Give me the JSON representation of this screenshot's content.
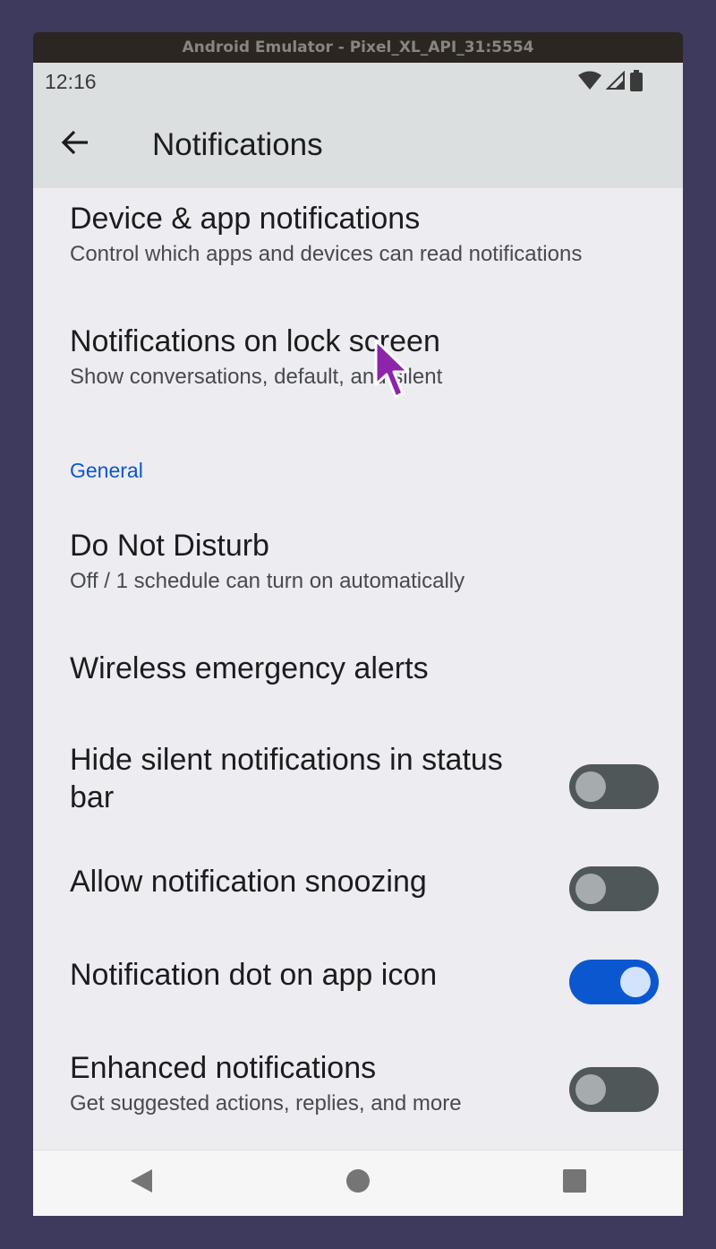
{
  "window": {
    "title": "Android Emulator - Pixel_XL_API_31:5554"
  },
  "status_bar": {
    "time": "12:16",
    "icons": [
      "wifi-icon",
      "cell-signal-icon",
      "battery-icon"
    ]
  },
  "app_bar": {
    "title": "Notifications",
    "back_icon": "arrow-back-icon"
  },
  "items": {
    "device_app": {
      "title": "Device & app notifications",
      "subtitle": "Control which apps and devices can read notifications"
    },
    "lock_screen": {
      "title": "Notifications on lock screen",
      "subtitle": "Show conversations, default, and silent"
    },
    "general_header": "General",
    "dnd": {
      "title": "Do Not Disturb",
      "subtitle": "Off / 1 schedule can turn on automatically"
    },
    "wea": {
      "title": "Wireless emergency alerts"
    },
    "hide_silent": {
      "title_line1": "Hide silent notifications in status",
      "title_line2": "bar",
      "checked": false
    },
    "snooze": {
      "title": "Allow notification snoozing",
      "checked": false
    },
    "dot": {
      "title": "Notification dot on app icon",
      "checked": true
    },
    "enhanced": {
      "title": "Enhanced notifications",
      "subtitle": "Get suggested actions, replies, and more",
      "checked": false
    }
  },
  "nav_bar": {
    "icons": [
      "back-triangle-icon",
      "home-circle-icon",
      "recents-square-icon"
    ]
  },
  "colors": {
    "accent": "#0b57d0",
    "cursor": "#8e24aa",
    "background": "#edecf1"
  }
}
